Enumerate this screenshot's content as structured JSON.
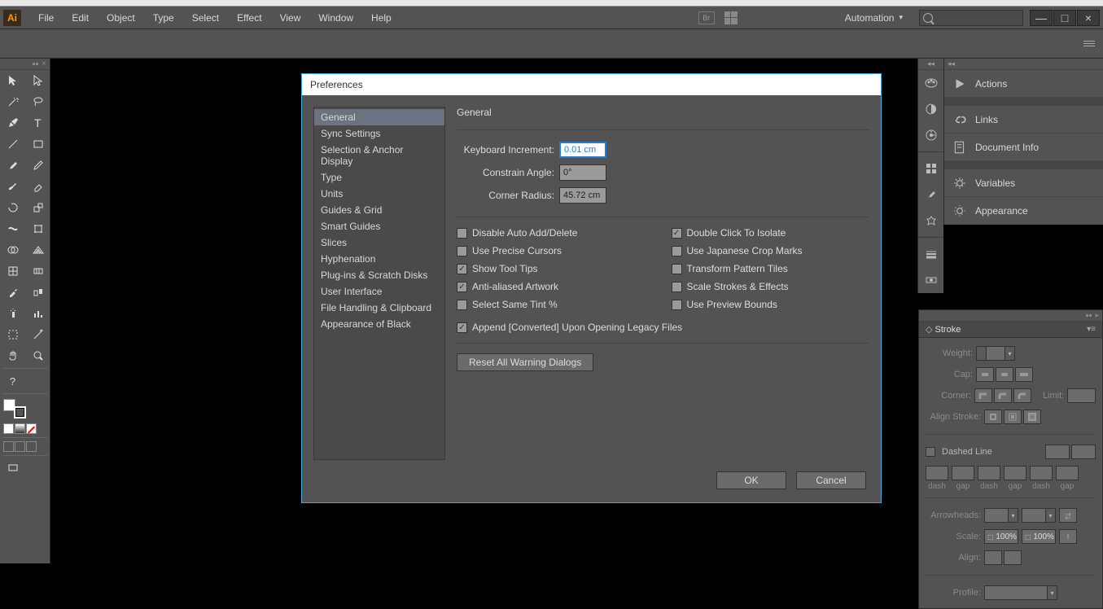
{
  "menu": {
    "items": [
      "File",
      "Edit",
      "Object",
      "Type",
      "Select",
      "Effect",
      "View",
      "Window",
      "Help"
    ],
    "automation": "Automation"
  },
  "dialog": {
    "title": "Preferences",
    "categories": [
      "General",
      "Sync Settings",
      "Selection & Anchor Display",
      "Type",
      "Units",
      "Guides & Grid",
      "Smart Guides",
      "Slices",
      "Hyphenation",
      "Plug-ins & Scratch Disks",
      "User Interface",
      "File Handling & Clipboard",
      "Appearance of Black"
    ],
    "selectedCategory": 0,
    "section": "General",
    "fields": {
      "keyboardIncrement": {
        "label": "Keyboard Increment:",
        "value": "0.01 cm"
      },
      "constrainAngle": {
        "label": "Constrain Angle:",
        "value": "0°"
      },
      "cornerRadius": {
        "label": "Corner Radius:",
        "value": "45.72 cm"
      }
    },
    "checksLeft": [
      {
        "label": "Disable Auto Add/Delete",
        "checked": false
      },
      {
        "label": "Use Precise Cursors",
        "checked": false
      },
      {
        "label": "Show Tool Tips",
        "checked": true
      },
      {
        "label": "Anti-aliased Artwork",
        "checked": true
      },
      {
        "label": "Select Same Tint %",
        "checked": false
      }
    ],
    "checksRight": [
      {
        "label": "Double Click To Isolate",
        "checked": true
      },
      {
        "label": "Use Japanese Crop Marks",
        "checked": false
      },
      {
        "label": "Transform Pattern Tiles",
        "checked": false
      },
      {
        "label": "Scale Strokes & Effects",
        "checked": false
      },
      {
        "label": "Use Preview Bounds",
        "checked": false
      }
    ],
    "appendLegacy": {
      "label": "Append [Converted] Upon Opening Legacy Files",
      "checked": true
    },
    "resetWarnings": "Reset All Warning Dialogs",
    "ok": "OK",
    "cancel": "Cancel"
  },
  "rightPanels": {
    "items": [
      {
        "id": "actions",
        "label": "Actions"
      },
      {
        "id": "links",
        "label": "Links"
      },
      {
        "id": "docinfo",
        "label": "Document Info"
      },
      {
        "id": "variables",
        "label": "Variables"
      },
      {
        "id": "appearance",
        "label": "Appearance"
      }
    ]
  },
  "stroke": {
    "title": "Stroke",
    "labels": {
      "weight": "Weight:",
      "cap": "Cap:",
      "corner": "Corner:",
      "limit": "Limit:",
      "align": "Align Stroke:",
      "dashed": "Dashed Line",
      "dash": "dash",
      "gap": "gap",
      "arrowheads": "Arrowheads:",
      "scale": "Scale:",
      "alignArrow": "Align:",
      "profile": "Profile:"
    },
    "scale1": "100%",
    "scale2": "100%"
  }
}
